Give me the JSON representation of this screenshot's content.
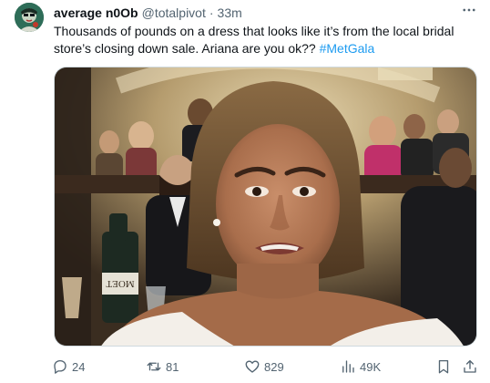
{
  "tweet": {
    "author": {
      "display_name": "average n0Ob",
      "handle": "@totalpivot",
      "separator": "·",
      "time": "33m",
      "avatar_icon": "avatar-illustration"
    },
    "text": {
      "body": "Thousands of pounds on a dress that looks like it’s from the local bridal store’s closing down sale. Ariana are you ok?? ",
      "hashtag": "#MetGala"
    },
    "media": {
      "type": "photo",
      "bottle_label": "MOET"
    },
    "actions": {
      "replies": "24",
      "retweets": "81",
      "likes": "829",
      "views": "49K"
    },
    "icons": {
      "more": "more-horizontal-icon",
      "reply": "reply-icon",
      "retweet": "retweet-icon",
      "like": "heart-icon",
      "views": "views-icon",
      "bookmark": "bookmark-icon",
      "share": "share-icon"
    },
    "colors": {
      "text": "#0f1419",
      "secondary": "#536471",
      "hashtag": "#1d9bf0"
    }
  }
}
